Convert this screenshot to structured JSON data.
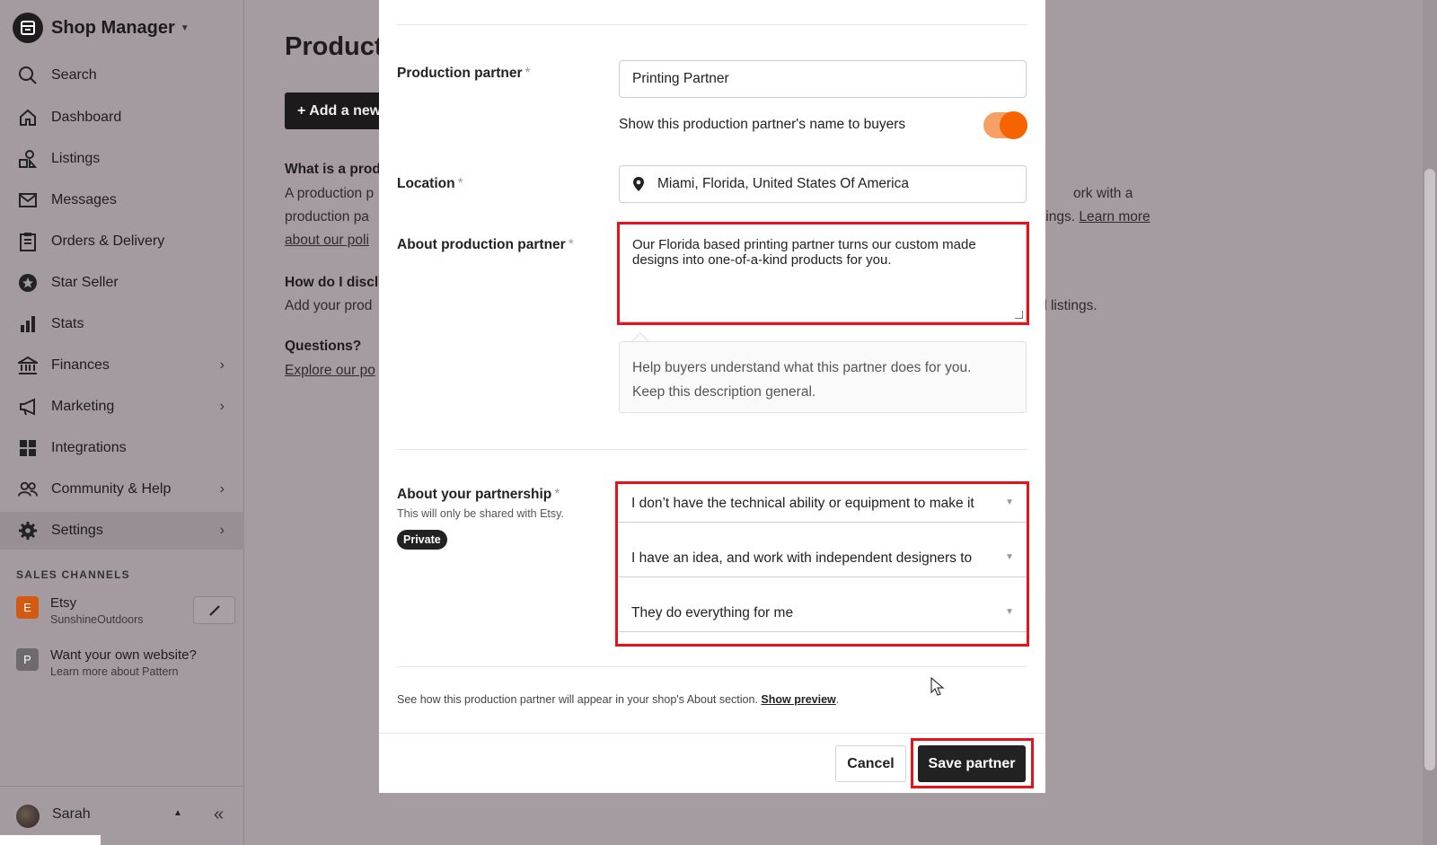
{
  "sidebar": {
    "shop_title": "Shop Manager",
    "nav": [
      {
        "label": "Search",
        "icon": "search-icon"
      },
      {
        "label": "Dashboard",
        "icon": "home-icon"
      },
      {
        "label": "Listings",
        "icon": "listings-icon"
      },
      {
        "label": "Messages",
        "icon": "mail-icon"
      },
      {
        "label": "Orders & Delivery",
        "icon": "clipboard-icon"
      },
      {
        "label": "Star Seller",
        "icon": "star-badge-icon"
      },
      {
        "label": "Stats",
        "icon": "bar-chart-icon"
      },
      {
        "label": "Finances",
        "icon": "bank-icon"
      },
      {
        "label": "Marketing",
        "icon": "megaphone-icon"
      },
      {
        "label": "Integrations",
        "icon": "grid-icon"
      },
      {
        "label": "Community & Help",
        "icon": "people-icon"
      },
      {
        "label": "Settings",
        "icon": "gear-icon"
      }
    ],
    "sales_channels_title": "SALES CHANNELS",
    "channels": [
      {
        "badge": "E",
        "name": "Etsy",
        "sub": "SunshineOutdoors",
        "color": "#d45a12"
      },
      {
        "badge": "P",
        "name": "Want your own website?",
        "sub": "Learn more about Pattern",
        "color": "#6e6a6d"
      }
    ],
    "user_name": "Sarah"
  },
  "background": {
    "page_title": "Product",
    "add_button": "+ Add a new",
    "what_heading": "What is a prod",
    "what_line1": "A production p",
    "what_line1_right": "ork with a",
    "what_line2": "production pa",
    "what_line2_right": "tings.",
    "learn_more": "Learn more",
    "policy_link": "about our poli",
    "how_heading": "How do I discl",
    "how_line": "Add your prod",
    "how_line_right": "ual listings.",
    "questions_heading": "Questions?",
    "explore_link": "Explore our po"
  },
  "modal": {
    "partner_label": "Production partner",
    "partner_value": "Printing Partner",
    "show_name_label": "Show this production partner's name to buyers",
    "location_label": "Location",
    "location_value": "Miami, Florida, United States Of America",
    "about_label": "About production partner",
    "about_value": "Our Florida based printing partner turns our custom made designs into one-of-a-kind products for you.",
    "help_line1": "Help buyers understand what this partner does for you.",
    "help_line2": "Keep this description general.",
    "partnership_label": "About your partnership",
    "partnership_note": "This will only be shared with Etsy.",
    "private_badge": "Private",
    "selects": [
      "I don’t have the technical ability or equipment to make it",
      "I have an idea, and work with independent designers to",
      "They do everything for me"
    ],
    "preview_note": "See how this production partner will appear in your shop's About section.",
    "preview_link": "Show preview",
    "cancel": "Cancel",
    "save": "Save partner",
    "required_mark": "*"
  }
}
